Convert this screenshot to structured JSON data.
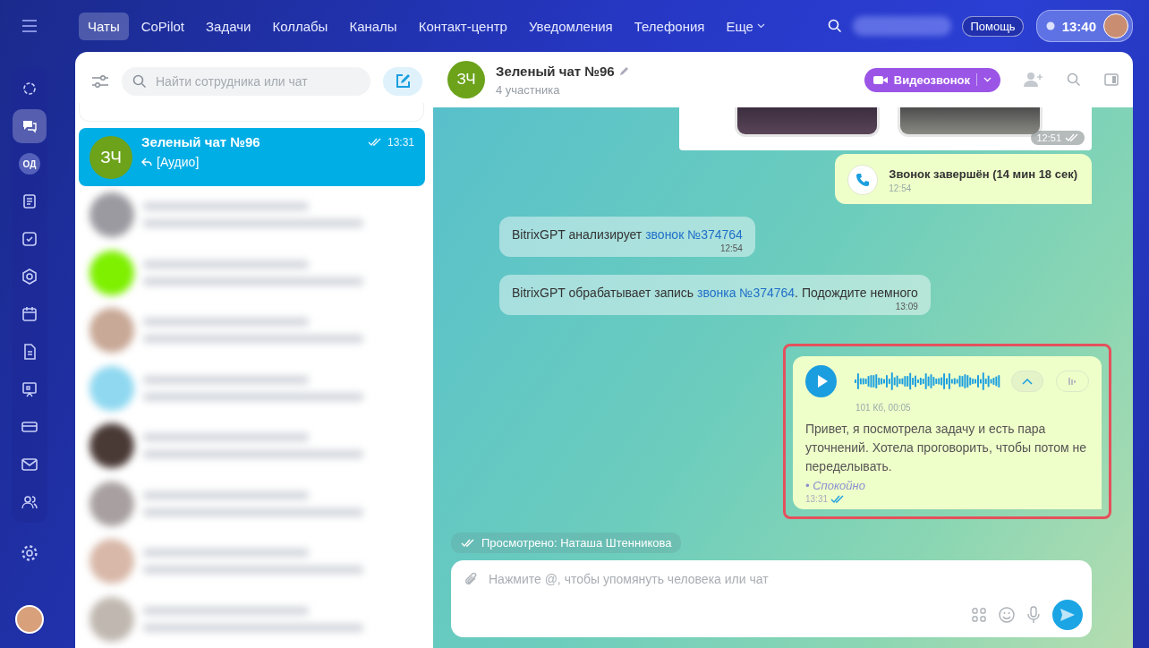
{
  "sidebar": {
    "items": [
      {
        "selected": false
      },
      {
        "selected": true
      },
      {
        "label": "ОД",
        "selected": false
      },
      {
        "selected": false
      },
      {
        "selected": false
      },
      {
        "selected": false
      },
      {
        "selected": false
      },
      {
        "selected": false
      },
      {
        "selected": false
      },
      {
        "selected": false
      },
      {
        "selected": false
      },
      {
        "selected": false
      }
    ]
  },
  "top_nav": {
    "tabs": [
      {
        "label": "Чаты",
        "selected": true
      },
      {
        "label": "CoPilot",
        "selected": false
      },
      {
        "label": "Задачи",
        "selected": false
      },
      {
        "label": "Коллабы",
        "selected": false
      },
      {
        "label": "Каналы",
        "selected": false
      },
      {
        "label": "Контакт-центр",
        "selected": false
      },
      {
        "label": "Уведомления",
        "selected": false
      },
      {
        "label": "Телефония",
        "selected": false
      },
      {
        "label": "Еще",
        "selected": false
      }
    ],
    "help_button": "Помощь",
    "clock": "13:40"
  },
  "chat_list": {
    "search": {
      "placeholder": "Найти сотрудника или чат"
    },
    "items": [
      {
        "avatar": "ЗЧ",
        "title": "Зеленый чат №96",
        "time": "13:31",
        "preview": "[Аудио]",
        "read": true,
        "selected": true
      }
    ]
  },
  "chat": {
    "avatar": "ЗЧ",
    "title": "Зеленый чат №96",
    "subtitle": "4 участника",
    "video_call_button": "Видеозвонок",
    "messages": [
      {
        "kind": "image",
        "time": "12:51",
        "read": true
      },
      {
        "kind": "call",
        "text": "Звонок завершён (14 мин 18 сек)",
        "time": "12:54"
      },
      {
        "kind": "system",
        "text": "BitrixGPT анализирует ",
        "link": "звонок №374764",
        "time": "12:54"
      },
      {
        "kind": "system",
        "text": "BitrixGPT обрабатывает запись ",
        "link": "звонка №374764",
        "after": ". Подождите немного",
        "time": "13:09"
      },
      {
        "kind": "audio",
        "info": "101 Кб, 00:05",
        "transcript": "Привет, я посмотрела задачу и есть пара уточнений. Хотела проговорить, чтобы потом не переделывать.",
        "mood": "• Спокойно",
        "time": "13:31",
        "read": true,
        "highlighted": true
      }
    ],
    "seen_by": "Просмотрено: Наташа Штенникова",
    "composer": {
      "placeholder": "Нажмите @, чтобы упомянуть человека или чат"
    }
  }
}
